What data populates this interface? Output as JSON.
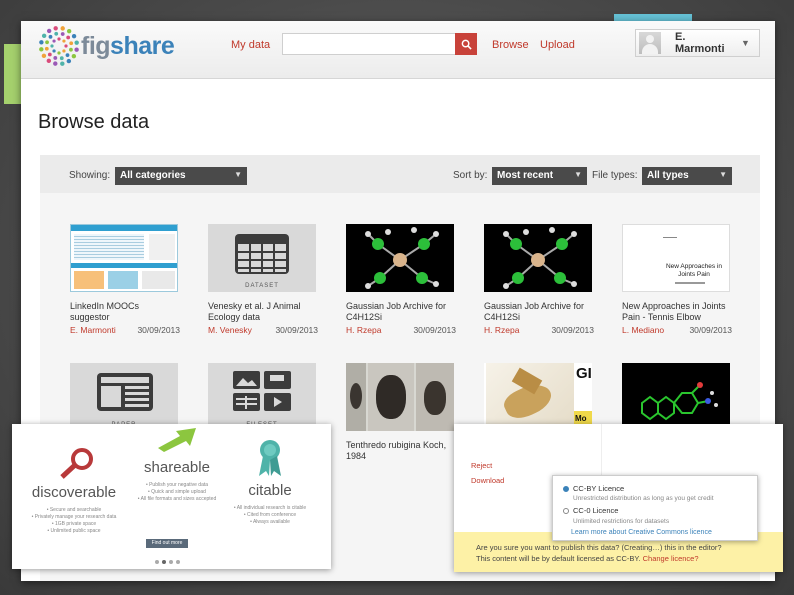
{
  "header": {
    "logo_part1": "fig",
    "logo_part2": "share",
    "nav_my_data": "My data",
    "nav_browse": "Browse",
    "nav_upload": "Upload",
    "search_placeholder": "",
    "user_name": "E. Marmonti"
  },
  "page": {
    "title": "Browse data"
  },
  "filters": {
    "showing_label": "Showing:",
    "showing_value": "All categories",
    "sort_label": "Sort by:",
    "sort_value": "Most recent",
    "filetypes_label": "File types:",
    "filetypes_value": "All types"
  },
  "items": [
    {
      "title": "LinkedIn MOOCs suggestor",
      "author": "E. Marmonti",
      "date": "30/09/2013"
    },
    {
      "title": "Venesky et al. J Animal Ecology data",
      "author": "M. Venesky",
      "date": "30/09/2013",
      "thumb_label": "DATASET"
    },
    {
      "title": "Gaussian Job Archive for C4H12Si",
      "author": "H. Rzepa",
      "date": "30/09/2013"
    },
    {
      "title": "Gaussian Job Archive for C4H12Si",
      "author": "H. Rzepa",
      "date": "30/09/2013"
    },
    {
      "title": "New Approaches in Joints Pain - Tennis Elbow",
      "author": "L. Mediano",
      "date": "30/09/2013",
      "thumb_text": "New Approaches in Joints Pain"
    },
    {
      "title": "",
      "thumb_label": "PAPER"
    },
    {
      "title": "",
      "thumb_label": "FILESET"
    },
    {
      "title": "Tenthredo rubigina Koch, 1984"
    },
    {
      "title": "",
      "thumb_text_a": "GI",
      "thumb_text_b": "Mo"
    },
    {
      "title": ""
    }
  ],
  "features": {
    "discoverable": "discoverable",
    "shareable": "shareable",
    "citable": "citable",
    "discoverable_lines": [
      "Secure and searchable",
      "Privately manage your research data",
      "1GB private space",
      "Unlimited public space"
    ],
    "shareable_lines": [
      "Publish your negative data",
      "Quick and simple upload",
      "All file formats and sizes accepted"
    ],
    "citable_lines": [
      "All individual research is citable",
      "Cited from conference",
      "Always available"
    ],
    "find_more": "Find out more"
  },
  "licence": {
    "reject": "Reject",
    "download": "Download",
    "ccby_label": "CC-BY Licence",
    "ccby_desc": "Unrestricted distribution as long as you get credit",
    "cc0_label": "CC-0 Licence",
    "cc0_desc": "Unlimited restrictions for datasets",
    "learn_more": "Learn more about Creative Commons licence",
    "confirm_line1": "Are you sure you want to publish this data? (Creating…) this in the editor?",
    "confirm_line2_text": "This content will be by default licensed as CC-BY.",
    "confirm_line2_link": "Change licence?"
  },
  "colors": {
    "brand_red": "#c0392b",
    "brand_blue": "#3b82b9",
    "filter_dark": "#4a4a4a",
    "accent_green": "#a5d16d",
    "accent_teal": "#66c2d6"
  }
}
